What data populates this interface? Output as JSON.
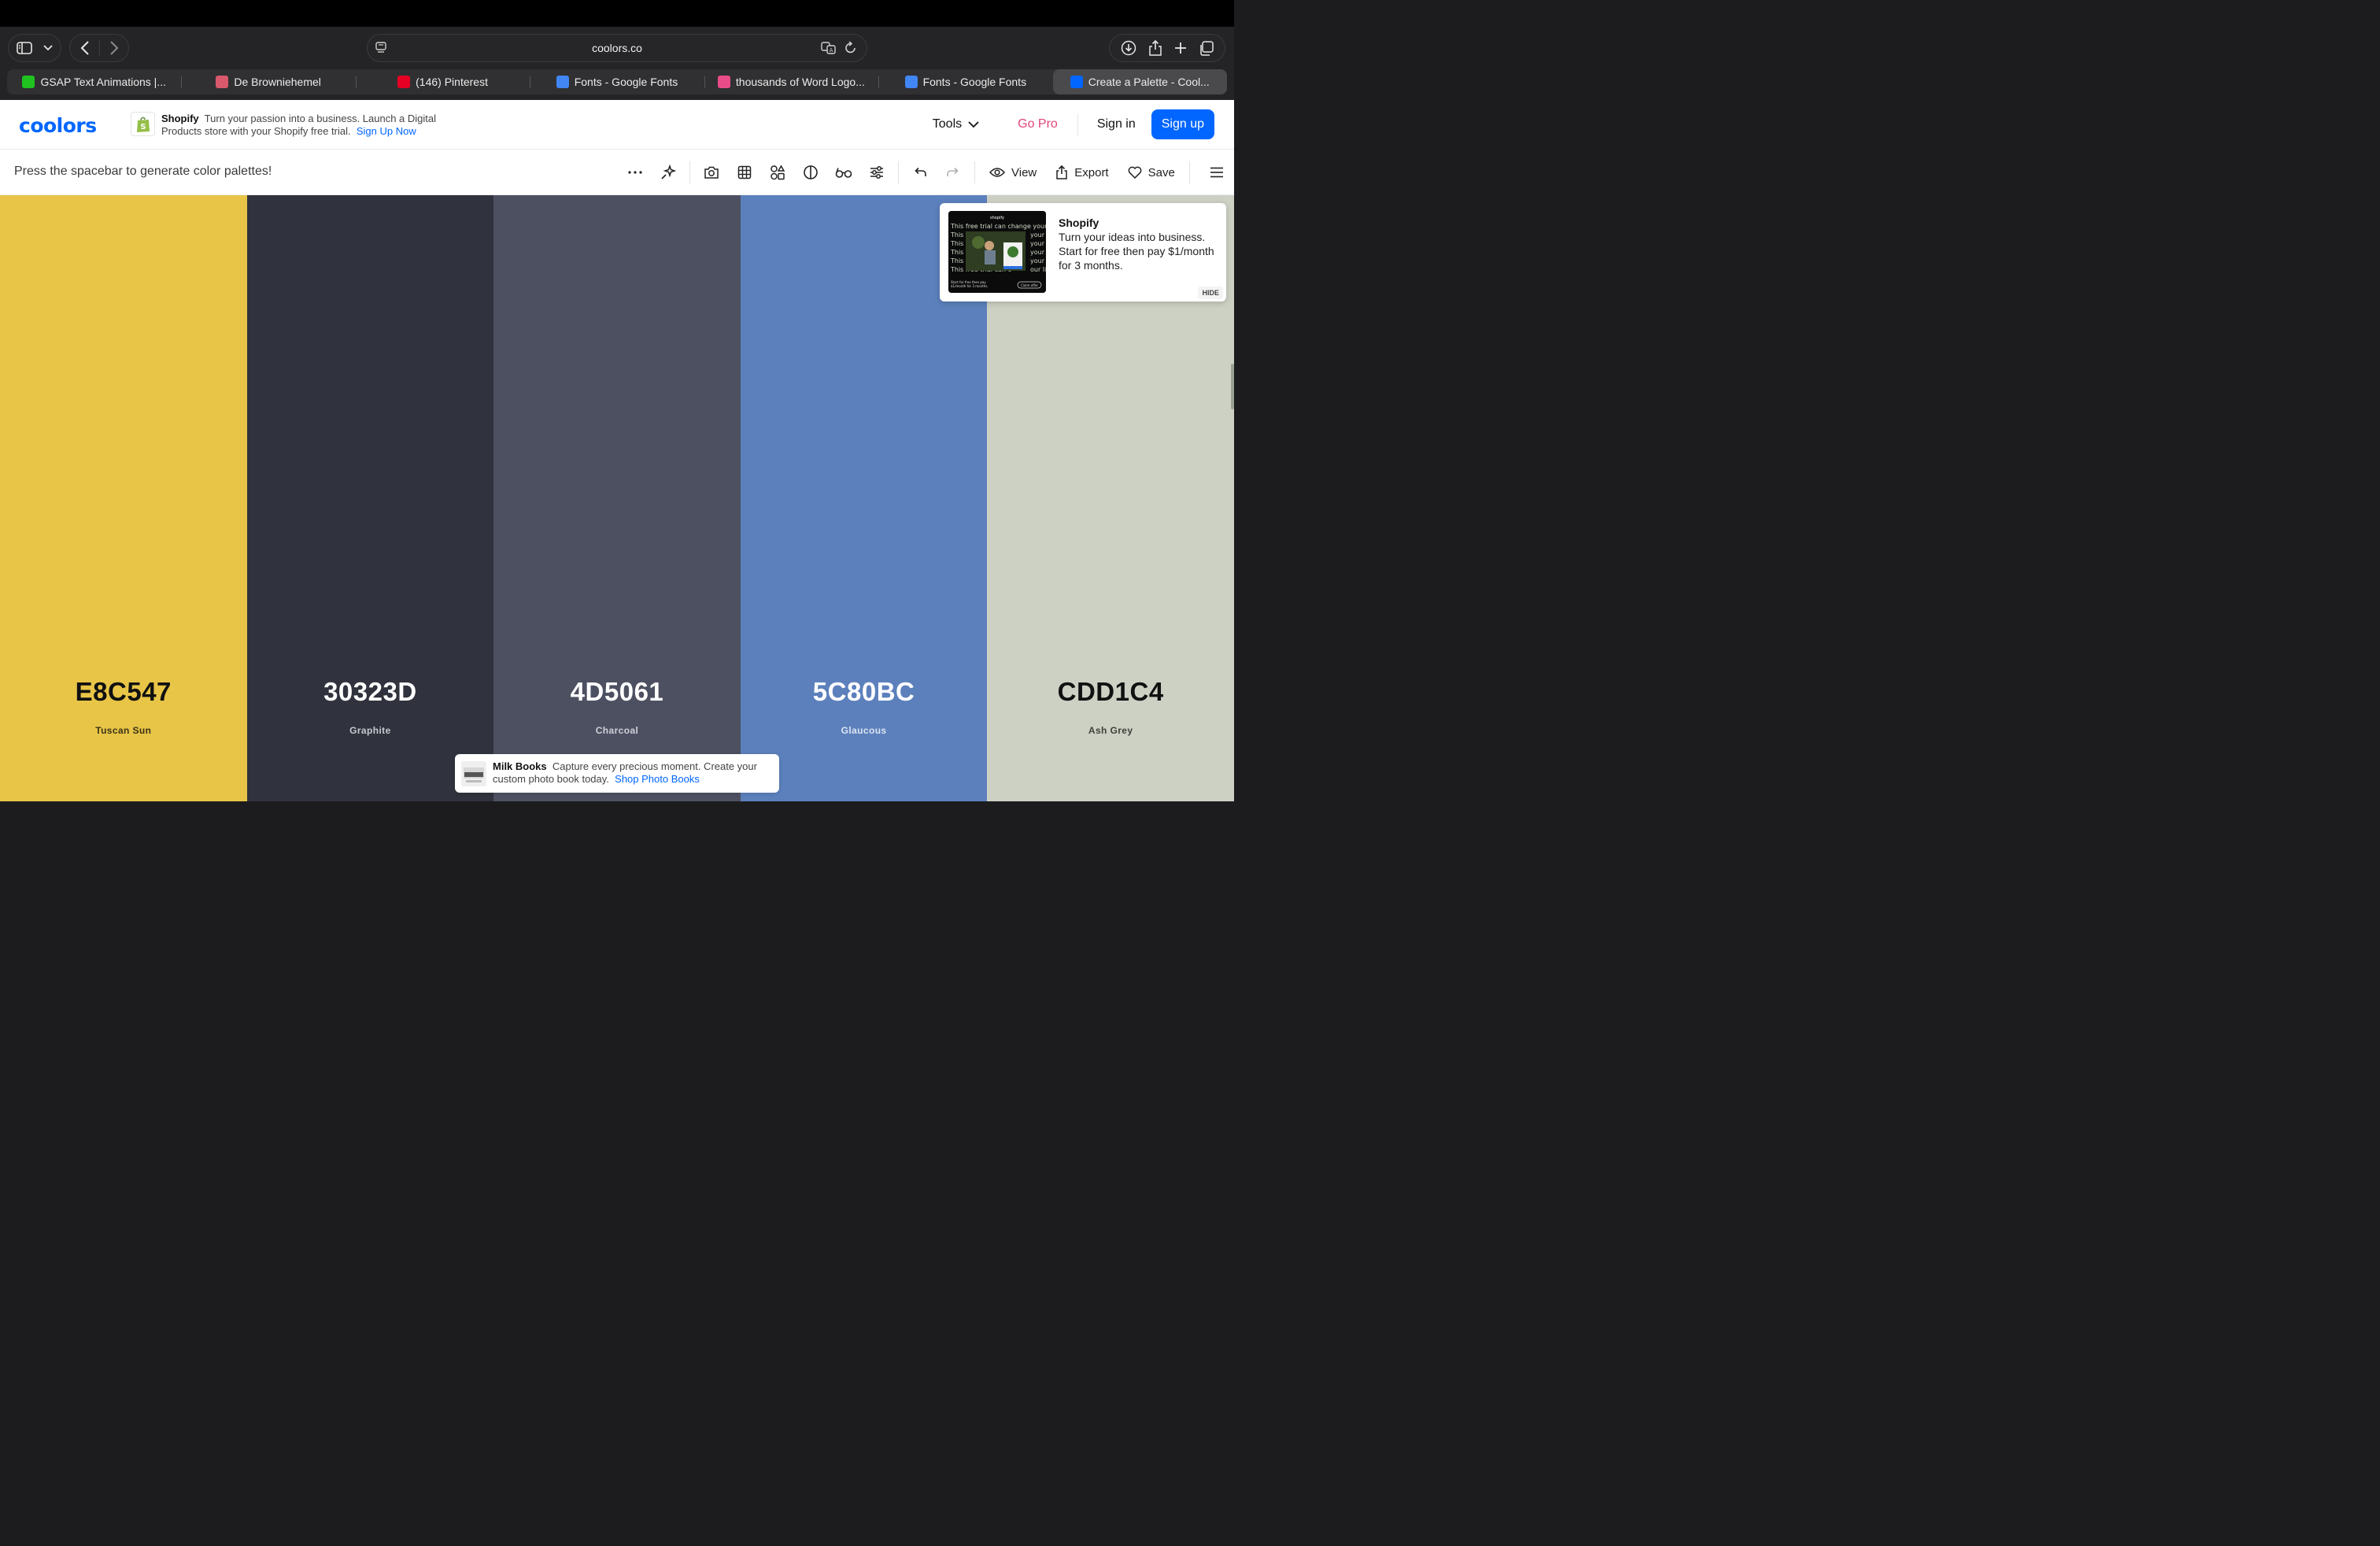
{
  "browser": {
    "url": "coolors.co",
    "tabs": [
      {
        "title": "GSAP Text Animations |...",
        "favicon_color": "#1fc21f"
      },
      {
        "title": "De Browniehemel",
        "favicon_color": "#d9596c"
      },
      {
        "title": "(146) Pinterest",
        "favicon_color": "#e60023"
      },
      {
        "title": "Fonts - Google Fonts",
        "favicon_color": "#4285f4"
      },
      {
        "title": "thousands of Word Logo...",
        "favicon_color": "#ea4c89"
      },
      {
        "title": "Fonts - Google Fonts",
        "favicon_color": "#4285f4"
      },
      {
        "title": "Create a Palette - Cool...",
        "favicon_color": "#0066ff",
        "active": true
      }
    ]
  },
  "header": {
    "logo": "coolors",
    "ad": {
      "brand": "Shopify",
      "text": "Turn your passion into a business. Launch a Digital Products store with your Shopify free trial.",
      "cta": "Sign Up Now"
    },
    "tools_label": "Tools",
    "gopro_label": "Go Pro",
    "signin_label": "Sign in",
    "signup_label": "Sign up"
  },
  "toolbar": {
    "hint": "Press the spacebar to generate color palettes!",
    "view_label": "View",
    "export_label": "Export",
    "save_label": "Save",
    "icons": [
      "more-icon",
      "magic-icon",
      "camera-icon",
      "grid-icon",
      "shapes-icon",
      "contrast-icon",
      "glasses-icon",
      "sliders-icon",
      "undo-icon",
      "redo-icon"
    ]
  },
  "palette": [
    {
      "hex": "E8C547",
      "name": "Tuscan Sun",
      "bg": "#E8C547",
      "fg": "#111111",
      "sub": "#3a3218"
    },
    {
      "hex": "30323D",
      "name": "Graphite",
      "bg": "#30323D",
      "fg": "#ffffff",
      "sub": "#c8c9d0"
    },
    {
      "hex": "4D5061",
      "name": "Charcoal",
      "bg": "#4D5061",
      "fg": "#ffffff",
      "sub": "#cfd0d8"
    },
    {
      "hex": "5C80BC",
      "name": "Glaucous",
      "bg": "#5C80BC",
      "fg": "#ffffff",
      "sub": "#dbe4f2"
    },
    {
      "hex": "CDD1C4",
      "name": "Ash Grey",
      "bg": "#CDD1C4",
      "fg": "#111111",
      "sub": "#3f4139"
    }
  ],
  "float_ad": {
    "title": "Shopify",
    "text": "Turn your ideas into business. Start for free then pay $1/month for 3 months.",
    "hide_label": "HIDE"
  },
  "bottom_ad": {
    "brand": "Milk Books",
    "text": "Capture every precious moment. Create your custom photo book today.",
    "cta": "Shop Photo Books"
  }
}
